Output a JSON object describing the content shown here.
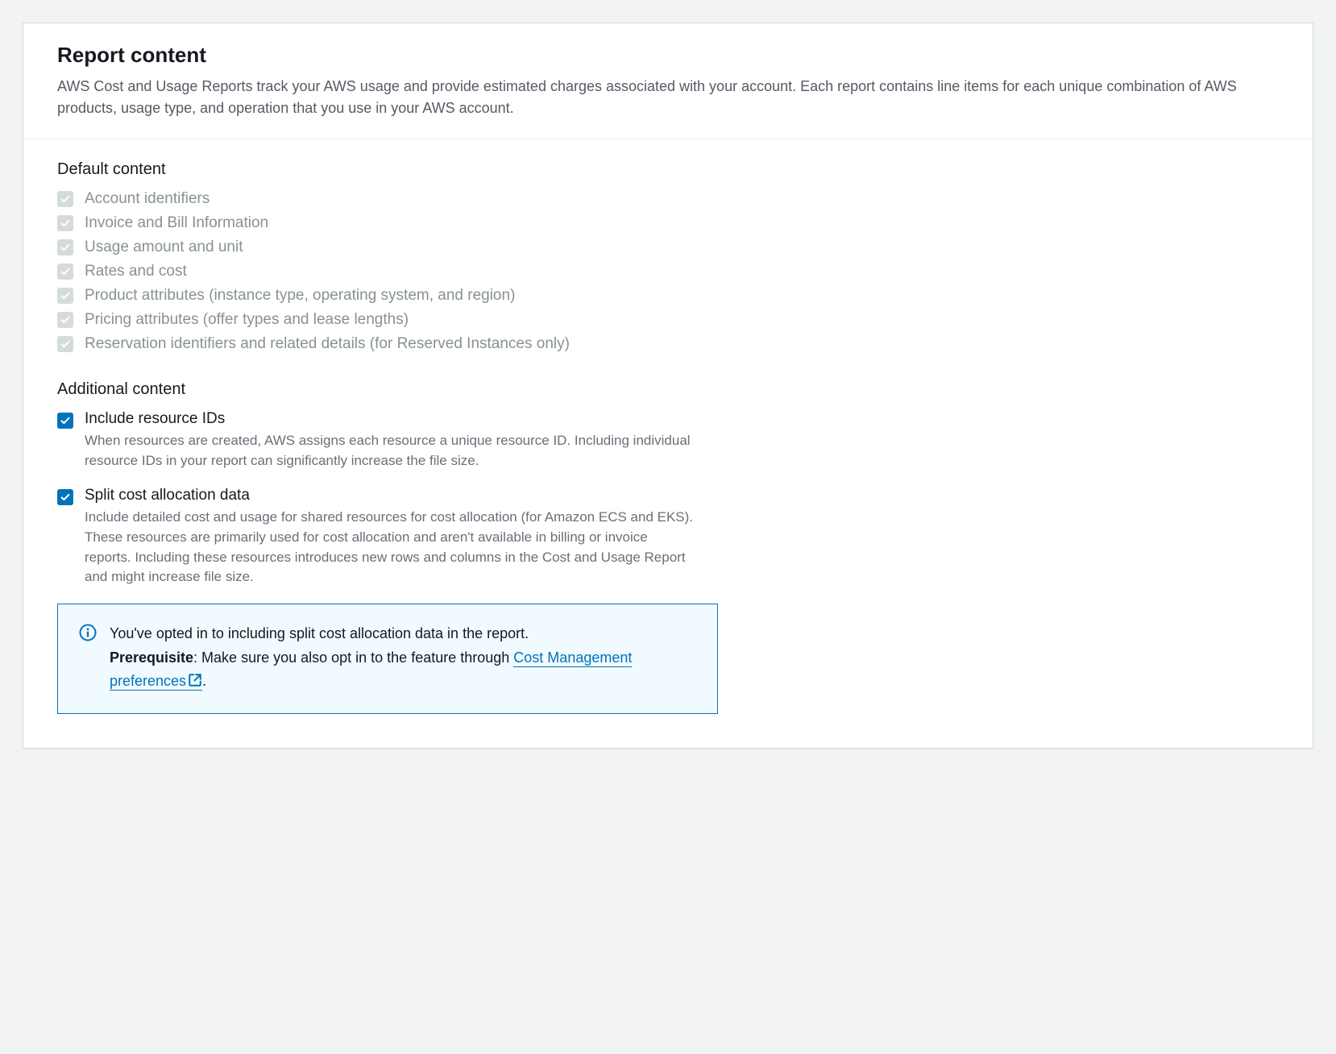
{
  "header": {
    "title": "Report content",
    "description": "AWS Cost and Usage Reports track your AWS usage and provide estimated charges associated with your account. Each report contains line items for each unique combination of AWS products, usage type, and operation that you use in your AWS account."
  },
  "default_content": {
    "heading": "Default content",
    "items": [
      "Account identifiers",
      "Invoice and Bill Information",
      "Usage amount and unit",
      "Rates and cost",
      "Product attributes (instance type, operating system, and region)",
      "Pricing attributes (offer types and lease lengths)",
      "Reservation identifiers and related details (for Reserved Instances only)"
    ]
  },
  "additional_content": {
    "heading": "Additional content",
    "items": [
      {
        "label": "Include resource IDs",
        "description": "When resources are created, AWS assigns each resource a unique resource ID. Including individual resource IDs in your report can significantly increase the file size.",
        "checked": true
      },
      {
        "label": "Split cost allocation data",
        "description": "Include detailed cost and usage for shared resources for cost allocation (for Amazon ECS and EKS). These resources are primarily used for cost allocation and aren't available in billing or invoice reports. Including these resources introduces new rows and columns in the Cost and Usage Report and might increase file size.",
        "checked": true
      }
    ]
  },
  "info_box": {
    "message": "You've opted in to including split cost allocation data in the report.",
    "prereq_label": "Prerequisite",
    "prereq_text": ": Make sure you also opt in to the feature through ",
    "link_text": "Cost Management preferences",
    "period": "."
  }
}
